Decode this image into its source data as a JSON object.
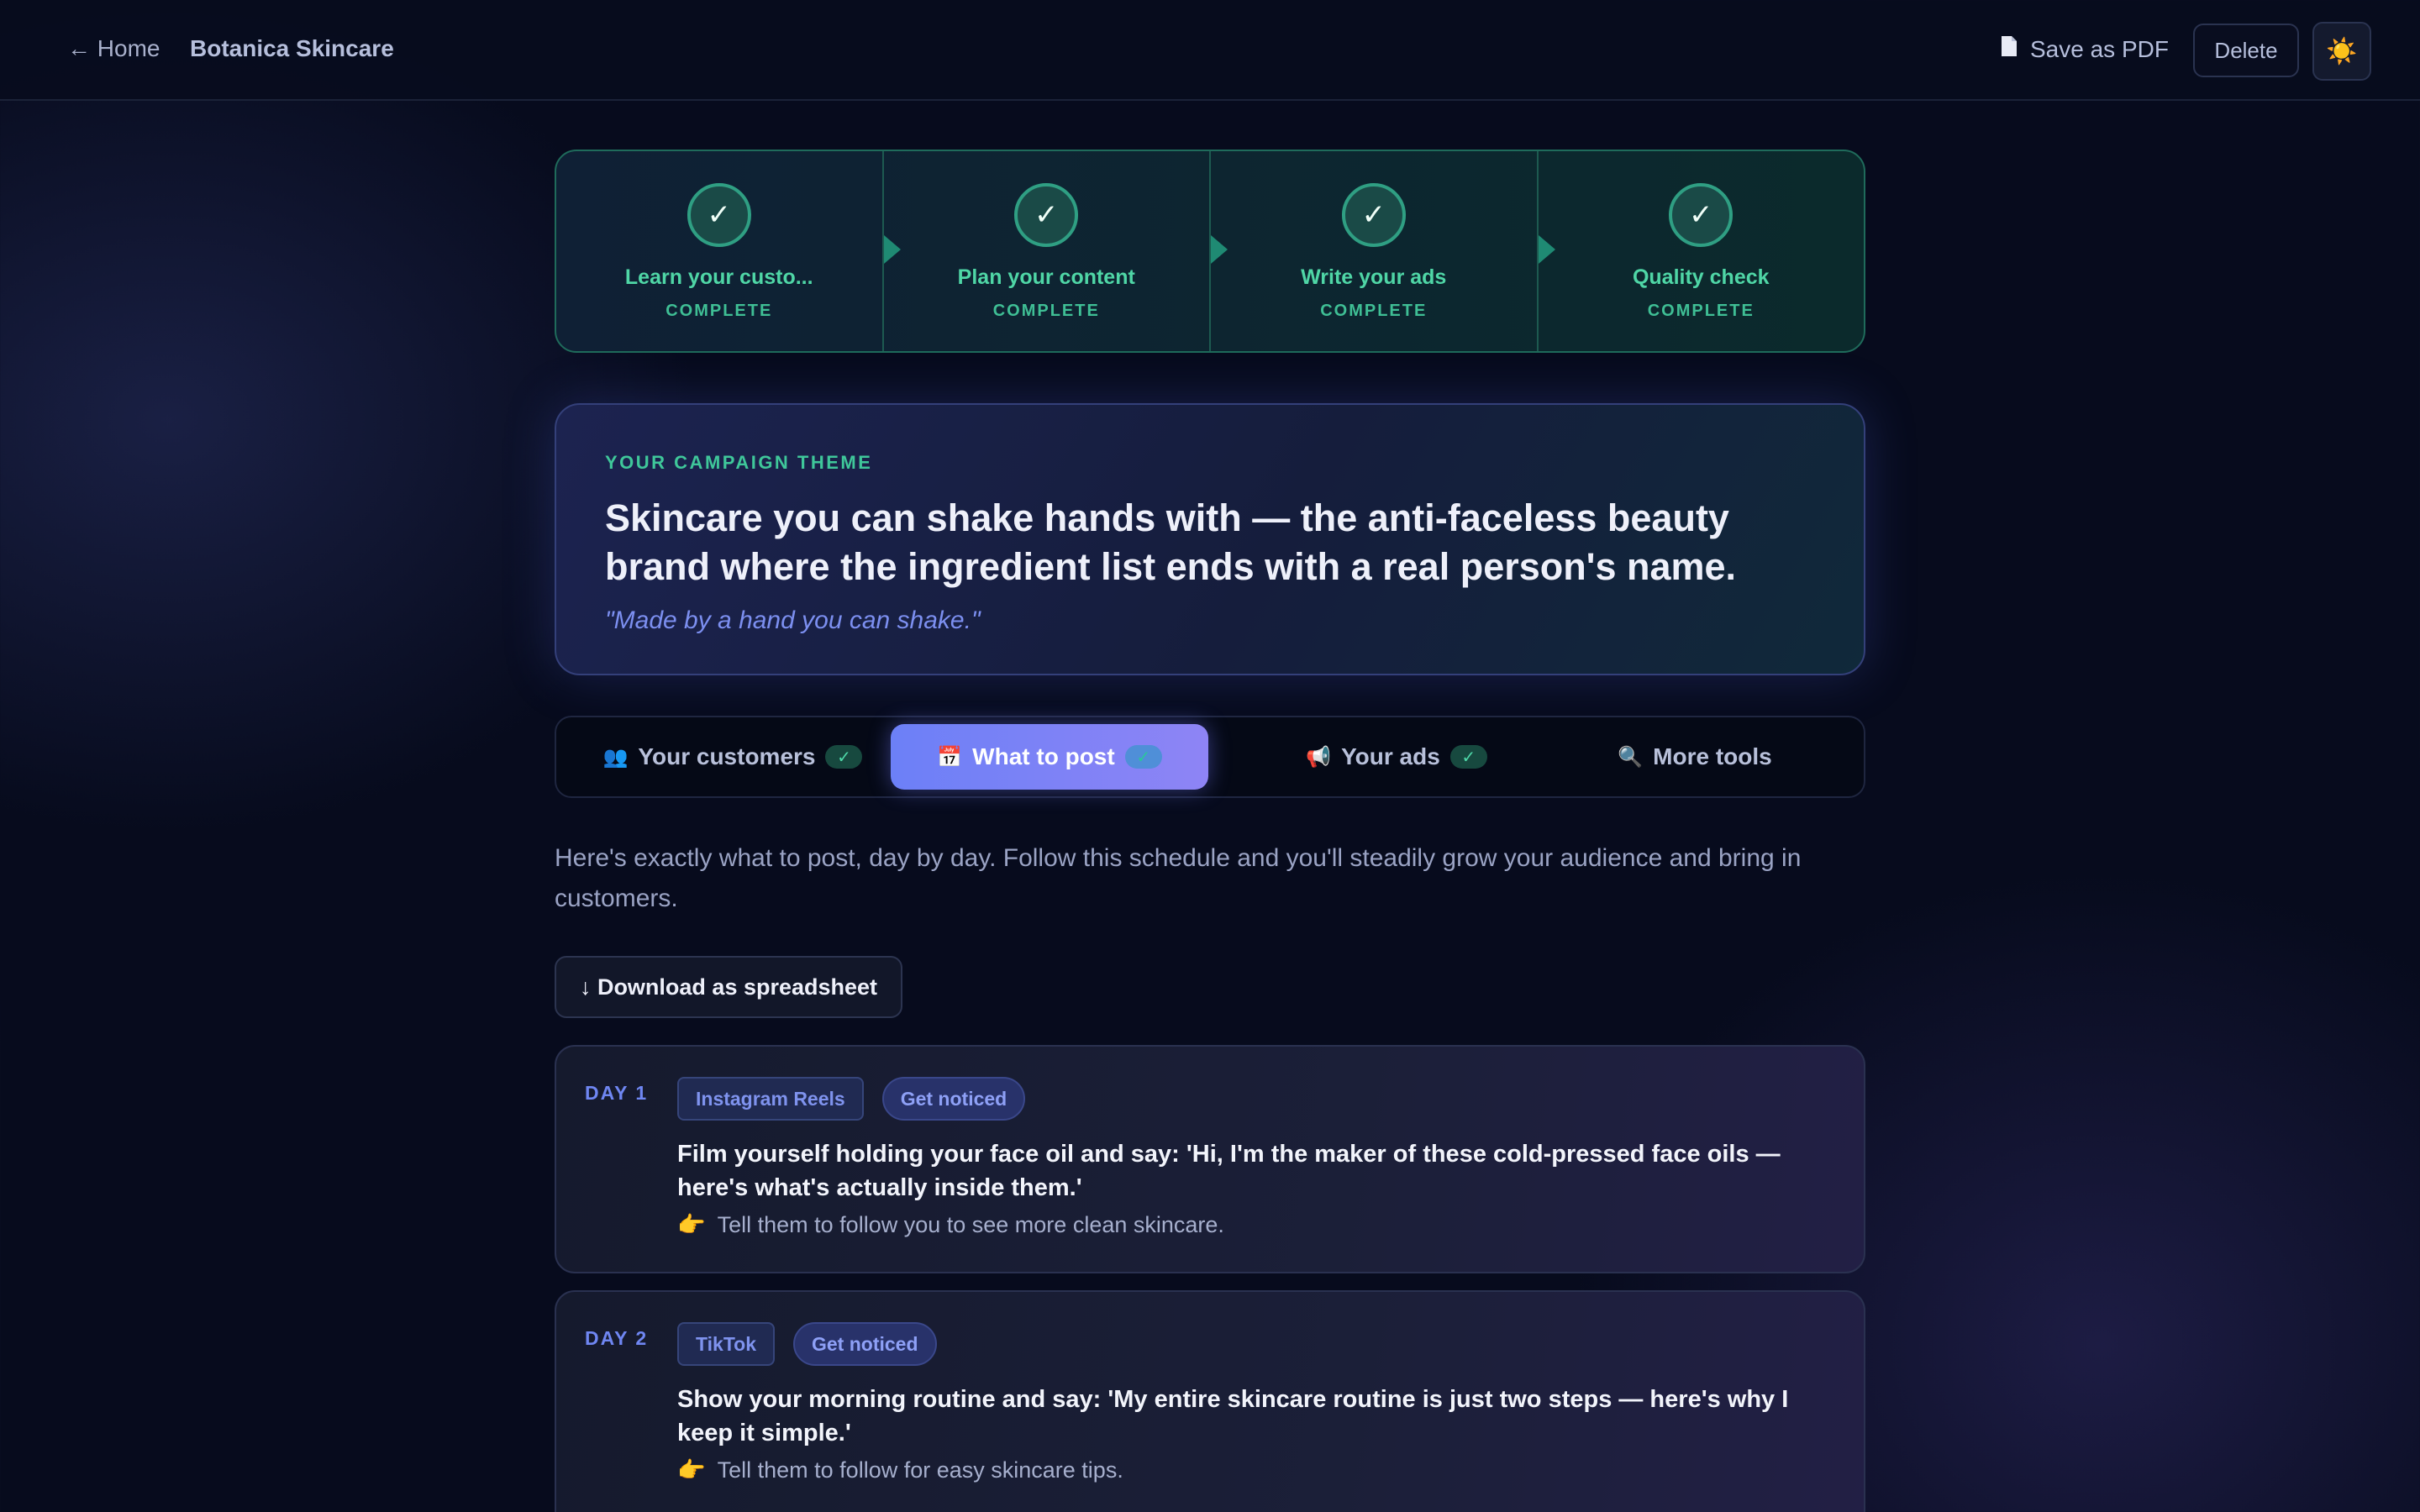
{
  "topbar": {
    "home_label": "← Home",
    "brand": "Botanica Skincare",
    "save_pdf_label": "Save as PDF",
    "delete_label": "Delete",
    "theme_toggle_icon": "☀️"
  },
  "steps": [
    {
      "title": "Learn your custo...",
      "status": "COMPLETE"
    },
    {
      "title": "Plan your content",
      "status": "COMPLETE"
    },
    {
      "title": "Write your ads",
      "status": "COMPLETE"
    },
    {
      "title": "Quality check",
      "status": "COMPLETE"
    }
  ],
  "campaign": {
    "label": "YOUR CAMPAIGN THEME",
    "theme": "Skincare you can shake hands with — the anti-faceless beauty brand where the ingredient list ends with a real person's name.",
    "tagline": "\"Made by a hand you can shake.\""
  },
  "tabs": [
    {
      "icon": "👥",
      "label": "Your customers",
      "check": "✓",
      "active": false
    },
    {
      "icon": "📅",
      "label": "What to post",
      "check": "✓",
      "active": true
    },
    {
      "icon": "📢",
      "label": "Your ads",
      "check": "✓",
      "active": false
    },
    {
      "icon": "🔍",
      "label": "More tools",
      "check": "",
      "active": false
    }
  ],
  "intro": "Here's exactly what to post, day by day. Follow this schedule and you'll steadily grow your audience and bring in customers.",
  "download_label": "↓ Download as spreadsheet",
  "days": [
    {
      "day": "DAY 1",
      "platform": "Instagram Reels",
      "goal": "Get noticed",
      "post": "Film yourself holding your face oil and say: 'Hi, I'm the maker of these cold-pressed face oils — here's what's actually inside them.'",
      "cta_icon": "👉",
      "cta": "Tell them to follow you to see more clean skincare."
    },
    {
      "day": "DAY 2",
      "platform": "TikTok",
      "goal": "Get noticed",
      "post": "Show your morning routine and say: 'My entire skincare routine is just two steps — here's why I keep it simple.'",
      "cta_icon": "👉",
      "cta": "Tell them to follow for easy skincare tips."
    }
  ],
  "colors": {
    "background": "#070b1d",
    "accent_green": "#4fd6a6",
    "accent_indigo": "#6c80f7"
  }
}
